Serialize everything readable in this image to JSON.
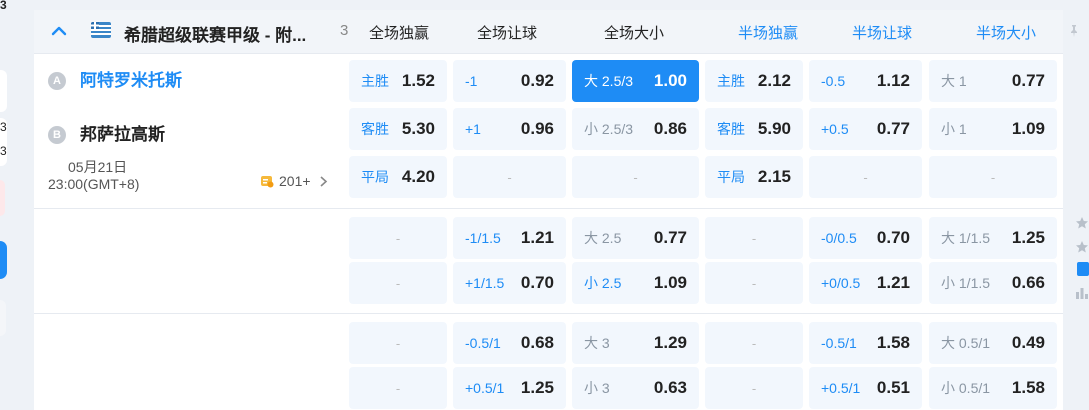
{
  "left_strip": {
    "t1": "3",
    "t2": "3",
    "t3": "3"
  },
  "header": {
    "league": "希腊超级联赛甲级 - 附...",
    "match_count": "3",
    "columns": [
      "全场独赢",
      "全场让球",
      "全场大小",
      "半场独赢",
      "半场让球",
      "半场大小"
    ]
  },
  "match": {
    "home_badge": "A",
    "home": "阿特罗米托斯",
    "away_badge": "B",
    "away": "邦萨拉高斯",
    "date": "05月21日",
    "time": "23:00(GMT+8)",
    "more": "201+"
  },
  "empty": "-",
  "rows": [
    {
      "c1": {
        "label": "主胜",
        "odds": "1.52"
      },
      "c2": {
        "label": "-1",
        "odds": "0.92"
      },
      "c3": {
        "label": "大 2.5/3",
        "odds": "1.00"
      },
      "c4": {
        "label": "主胜",
        "odds": "2.12"
      },
      "c5": {
        "label": "-0.5",
        "odds": "1.12"
      },
      "c6": {
        "label": "大 1",
        "odds": "0.77"
      }
    },
    {
      "c1": {
        "label": "客胜",
        "odds": "5.30"
      },
      "c2": {
        "label": "+1",
        "odds": "0.96"
      },
      "c3": {
        "label": "小 2.5/3",
        "odds": "0.86"
      },
      "c4": {
        "label": "客胜",
        "odds": "5.90"
      },
      "c5": {
        "label": "+0.5",
        "odds": "0.77"
      },
      "c6": {
        "label": "小 1",
        "odds": "1.09"
      }
    },
    {
      "c1": {
        "label": "平局",
        "odds": "4.20"
      },
      "c4": {
        "label": "平局",
        "odds": "2.15"
      }
    },
    {
      "c2": {
        "label": "-1/1.5",
        "odds": "1.21"
      },
      "c3": {
        "label": "大 2.5",
        "odds": "0.77"
      },
      "c5": {
        "label": "-0/0.5",
        "odds": "0.70"
      },
      "c6": {
        "label": "大 1/1.5",
        "odds": "1.25"
      }
    },
    {
      "c2": {
        "label": "+1/1.5",
        "odds": "0.70"
      },
      "c3": {
        "label": "小 2.5",
        "odds": "1.09"
      },
      "c5": {
        "label": "+0/0.5",
        "odds": "1.21"
      },
      "c6": {
        "label": "小 1/1.5",
        "odds": "0.66"
      }
    },
    {
      "c2": {
        "label": "-0.5/1",
        "odds": "0.68"
      },
      "c3": {
        "label": "大 3",
        "odds": "1.29"
      },
      "c5": {
        "label": "-0.5/1",
        "odds": "1.58"
      },
      "c6": {
        "label": "大 0.5/1",
        "odds": "0.49"
      }
    },
    {
      "c2": {
        "label": "+0.5/1",
        "odds": "1.25"
      },
      "c3": {
        "label": "小 3",
        "odds": "0.63"
      },
      "c5": {
        "label": "+0.5/1",
        "odds": "0.51"
      },
      "c6": {
        "label": "小 0.5/1",
        "odds": "1.58"
      }
    }
  ],
  "colors": {
    "accent": "#1e8cf5",
    "cell_bg": "#f2f7fd",
    "header_bg": "#f2f5f9"
  },
  "icons": [
    "chevron-up-icon",
    "league-flag-icon",
    "pin-icon",
    "more-markets-icon",
    "chevron-right-icon",
    "star-icon",
    "stats-icon"
  ]
}
